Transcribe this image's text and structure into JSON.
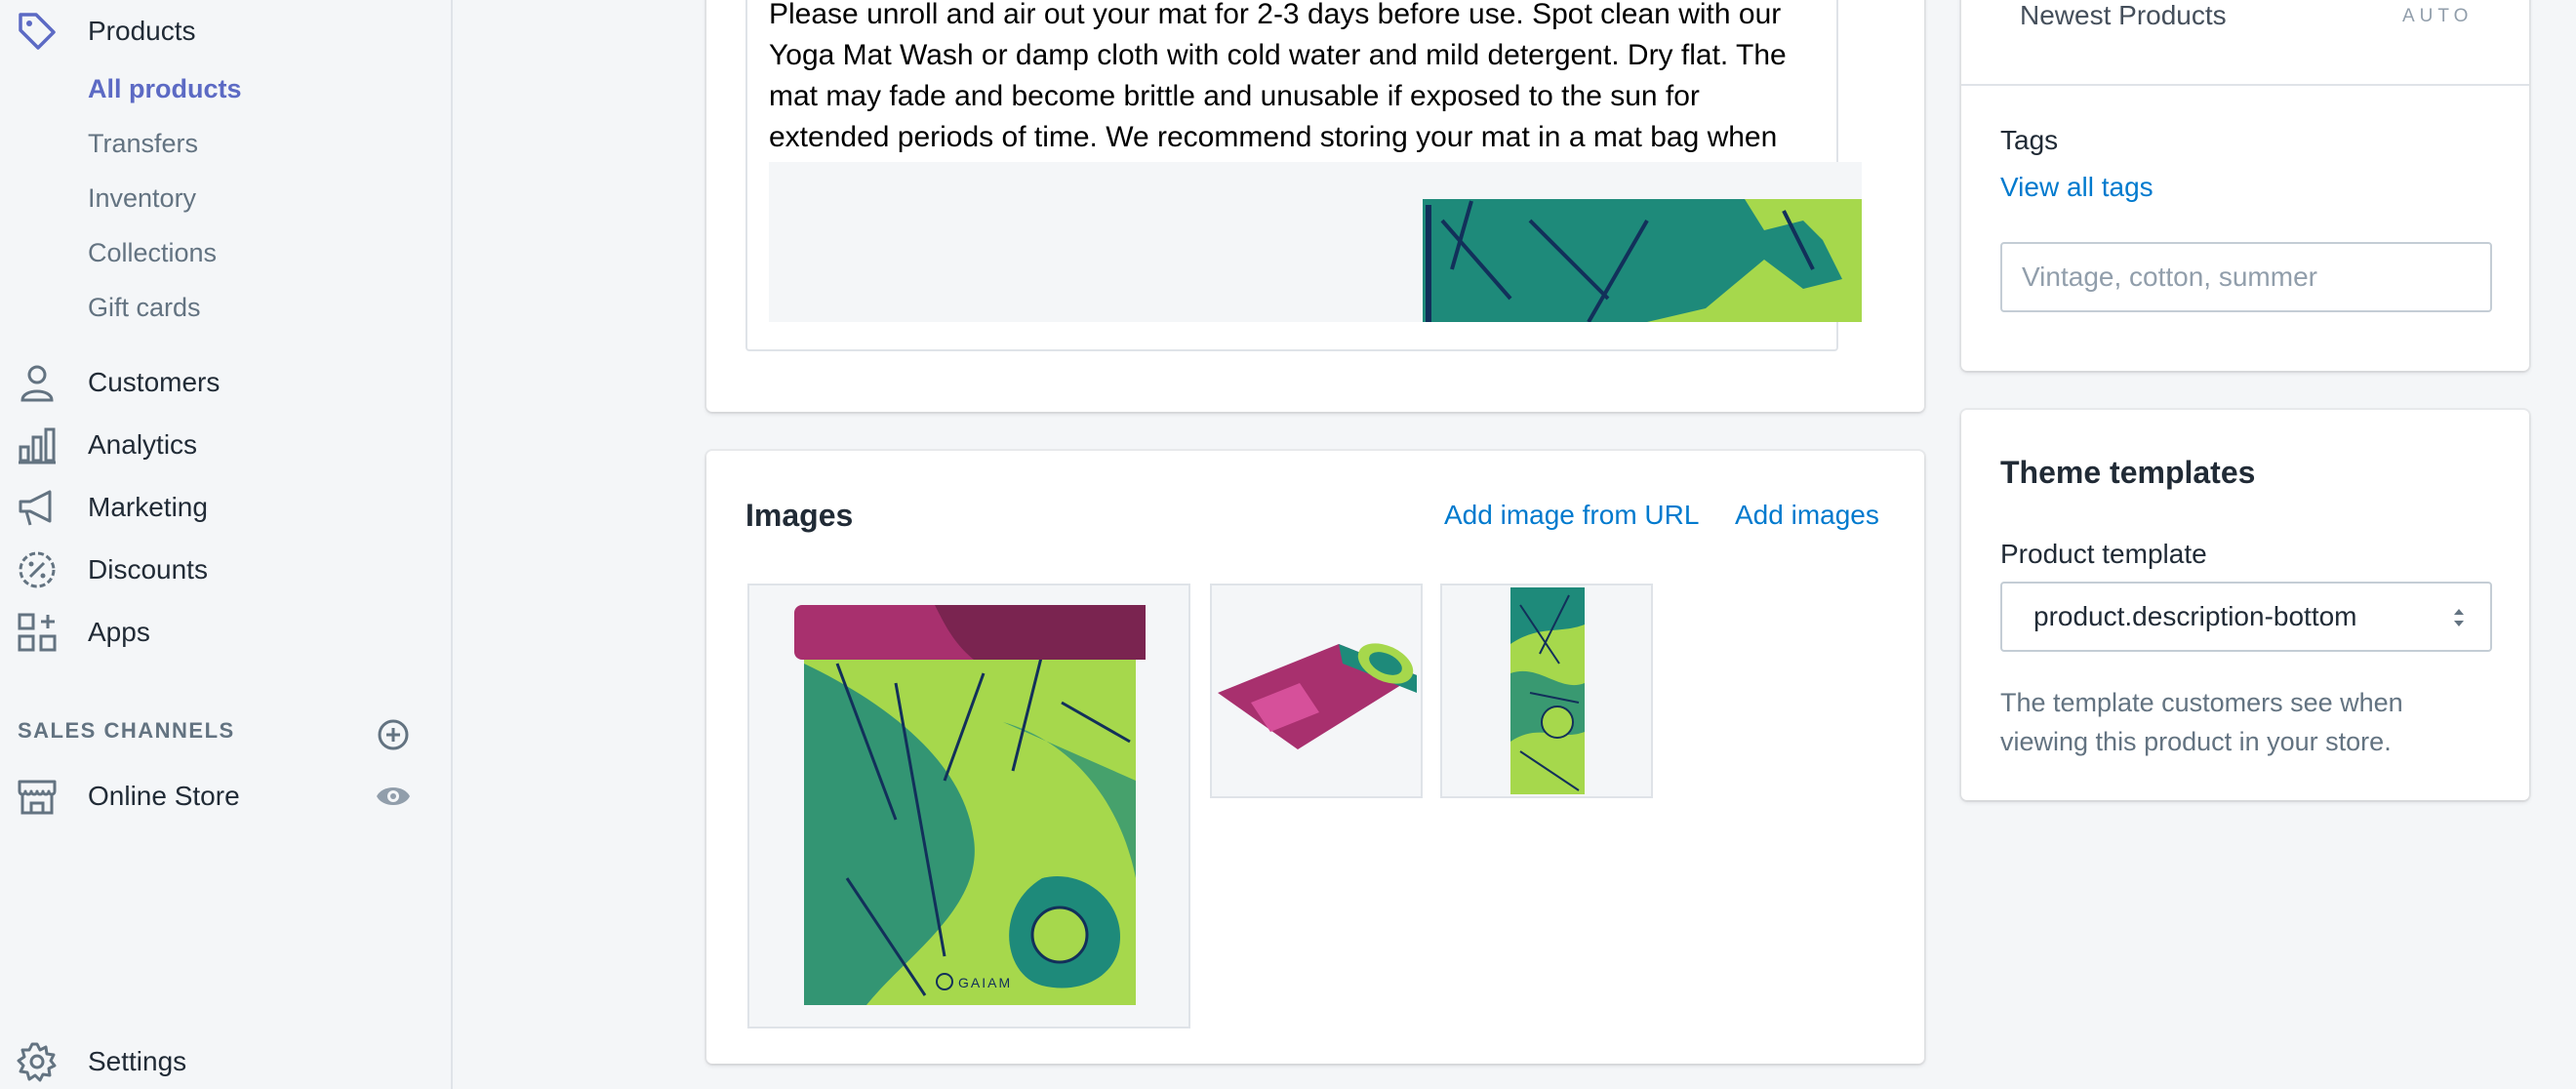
{
  "sidebar": {
    "products_label": "Products",
    "sub_items": [
      "All products",
      "Transfers",
      "Inventory",
      "Collections",
      "Gift cards"
    ],
    "customers_label": "Customers",
    "analytics_label": "Analytics",
    "marketing_label": "Marketing",
    "discounts_label": "Discounts",
    "apps_label": "Apps",
    "sales_channels_header": "SALES CHANNELS",
    "online_store_label": "Online Store",
    "settings_label": "Settings"
  },
  "description": {
    "text": "Please unroll and air out your mat for 2-3 days before use. Spot clean with our Yoga Mat Wash or damp cloth with cold water and mild detergent. Dry flat. The mat may fade and become brittle and unusable if exposed to the sun for extended periods of time. We recommend storing your mat in a mat bag when not in use."
  },
  "images_card": {
    "title": "Images",
    "add_from_url": "Add image from URL",
    "add_images": "Add images",
    "brand_mark": "GAIAM"
  },
  "collections": {
    "newest_products": "Newest Products",
    "auto_badge": "AUTO"
  },
  "tags": {
    "label": "Tags",
    "view_all": "View all tags",
    "placeholder": "Vintage, cotton, summer"
  },
  "theme_templates": {
    "title": "Theme templates",
    "product_template_label": "Product template",
    "selected": "product.description-bottom",
    "help": "The template customers see when viewing this product in your store."
  },
  "colors": {
    "accent": "#5c6ac4",
    "link": "#007ace",
    "mat_green": "#a6d84c",
    "mat_teal": "#1e8a7a",
    "mat_magenta": "#a8306e"
  }
}
